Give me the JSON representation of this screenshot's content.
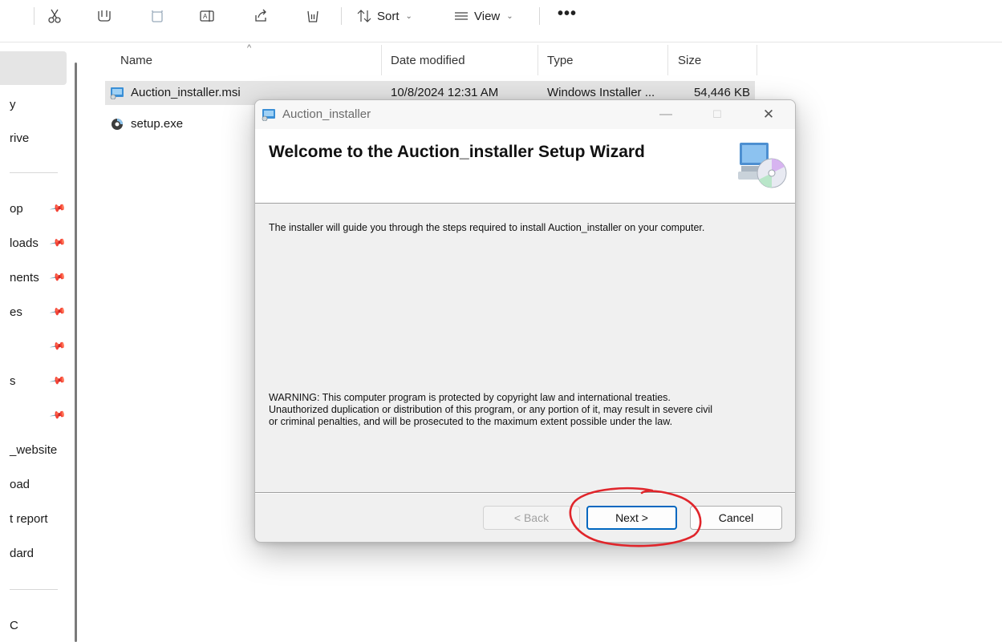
{
  "toolbar": {
    "sort_label": "Sort",
    "view_label": "View",
    "more_label": "•••",
    "icons": [
      "cut-icon",
      "copy-icon",
      "paste-icon",
      "rename-icon",
      "share-icon",
      "delete-icon",
      "sort-icon",
      "view-icon"
    ]
  },
  "nav": {
    "items": [
      {
        "label": "y"
      },
      {
        "label": "rive"
      },
      {
        "label": "op",
        "pinned": true
      },
      {
        "label": "loads",
        "pinned": true
      },
      {
        "label": "nents",
        "pinned": true
      },
      {
        "label": "es",
        "pinned": true
      },
      {
        "label": "",
        "pinned": true
      },
      {
        "label": "s",
        "pinned": true
      },
      {
        "label": "",
        "pinned": true
      },
      {
        "label": "_website"
      },
      {
        "label": "oad"
      },
      {
        "label": "t report"
      },
      {
        "label": "dard"
      },
      {
        "label": "C"
      }
    ]
  },
  "columns": {
    "name": "Name",
    "date": "Date modified",
    "type": "Type",
    "size": "Size",
    "sort_indicator": "^"
  },
  "files": [
    {
      "name": "Auction_installer.msi",
      "date": "10/8/2024 12:31 AM",
      "type": "Windows Installer ...",
      "size": "54,446 KB",
      "selected": true
    },
    {
      "name": "setup.exe",
      "date": "",
      "type": "",
      "size": "",
      "selected": false
    }
  ],
  "dialog": {
    "title": "Auction_installer",
    "minimize": "—",
    "maximize": "☐",
    "close": "✕",
    "heading": "Welcome to the Auction_installer Setup Wizard",
    "intro": "The installer will guide you through the steps required to install Auction_installer on your computer.",
    "warning": [
      "WARNING: This computer program is protected by copyright law and international treaties.",
      "Unauthorized duplication or distribution of this program, or any portion of it, may result in severe civil",
      "or criminal penalties, and will be prosecuted to the maximum extent possible under the law."
    ],
    "back_label": "< Back",
    "next_label": "Next >",
    "cancel_label": "Cancel"
  },
  "annotation": {
    "color": "#e0252b",
    "target": "next-button"
  }
}
